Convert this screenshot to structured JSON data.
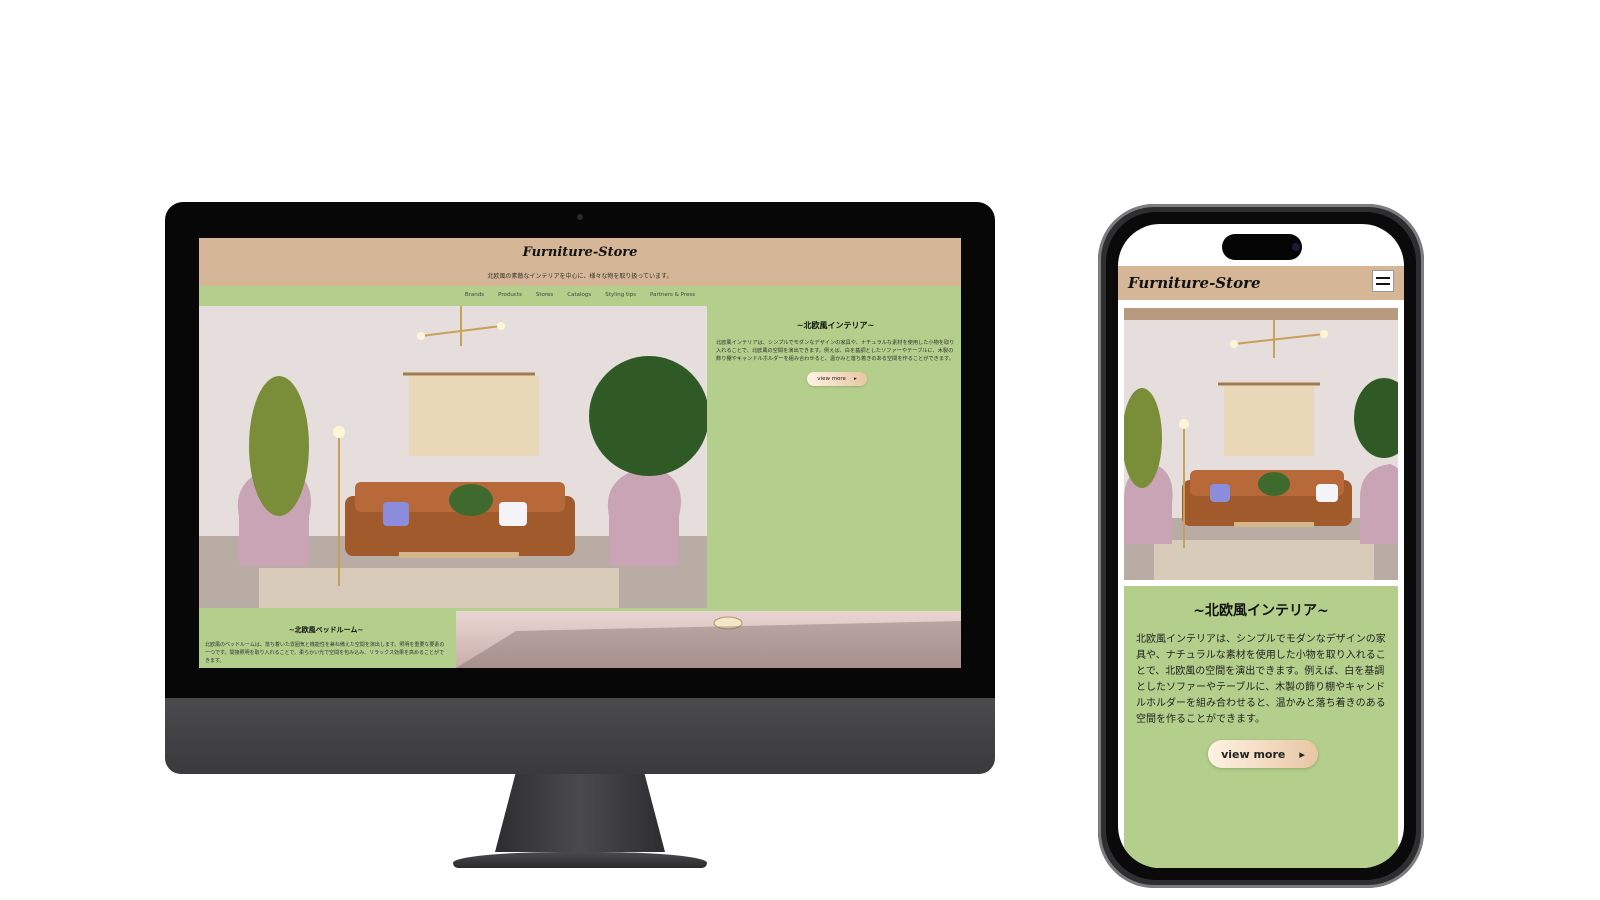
{
  "site": {
    "logo": "Furniture-Store",
    "tagline": "北欧風の素敵なインテリアを中心に、様々な物を取り扱っています。"
  },
  "nav": {
    "items": [
      "Brands",
      "Products",
      "Stores",
      "Catalogs",
      "Styling tips",
      "Partners & Press"
    ]
  },
  "hero_section": {
    "title": "~北欧風インテリア~",
    "body": "北欧風インテリアは、シンプルでモダンなデザインの家具や、ナチュラルな素材を使用した小物を取り入れることで、北欧風の空間を演出できます。例えば、白を基調としたソファーやテーブルに、木製の飾り棚やキャンドルホルダーを組み合わせると、温かみと落ち着きのある空間を作ることができます。",
    "button_label": "view more",
    "button_arrow": "▸"
  },
  "bedroom_section": {
    "title": "~北欧風ベッドルーム~",
    "body": "北欧風のベッドルームは、落ち着いた雰囲気と機能性を兼ね備えた空間を演出します。照明を重要な要素の一つです。間接照明を取り入れることで、柔らかい光で空間を包み込み、リラックス効果を高めることができます。"
  },
  "mobile": {
    "logo": "Furniture-Store",
    "menu_icon": "hamburger-menu-icon"
  },
  "colors": {
    "header": "#d5b696",
    "content": "#b3cf8b",
    "button_start": "#fff2e4",
    "button_end": "#e8c6a3"
  }
}
